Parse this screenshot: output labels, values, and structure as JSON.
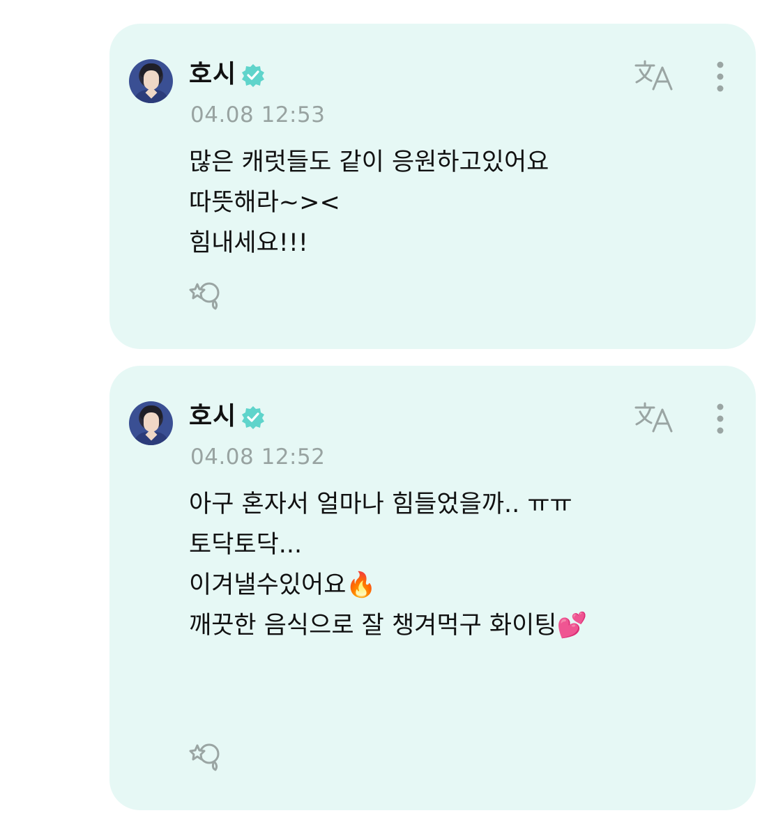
{
  "posts": [
    {
      "author": "호시",
      "timestamp": "04.08 12:53",
      "lines": [
        "많은 캐럿들도 같이 응원하고있어요",
        "따뜻해라~><",
        "힘내세요!!!"
      ]
    },
    {
      "author": "호시",
      "timestamp": "04.08 12:52",
      "lines": [
        "아구 혼자서 얼마나 힘들었을까.. ㅠㅠ",
        "토닥토닥...",
        "이겨낼수있어요🔥",
        "깨끗한 음식으로 잘 챙겨먹구 화이팅💕"
      ]
    }
  ],
  "icons": {
    "verified": "verified-badge-icon",
    "translate": "translate-icon",
    "more": "more-vertical-icon",
    "reaction": "add-reaction-icon"
  },
  "colors": {
    "card_background": "#e6f8f5",
    "verified_badge": "#5fd4cb",
    "timestamp": "#98a3a1",
    "icon": "#9aa5a3"
  }
}
